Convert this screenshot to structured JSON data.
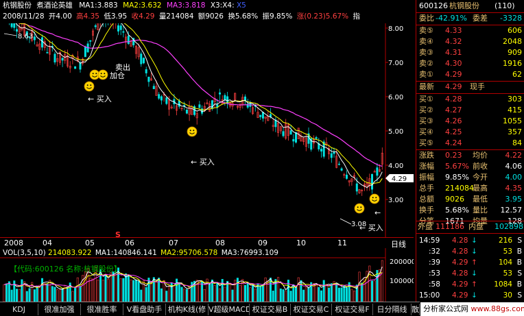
{
  "info": {
    "stock_name": "杭钢股份",
    "strategy_name": "煮酒论英雄",
    "ma1": "MA1:3.883",
    "ma2": "MA2:3.632",
    "ma3": "MA3:3.818",
    "x3x4": "X3:X4:",
    "x5": "X5",
    "date": "2008/11/28",
    "open": "开4.00",
    "high": "高4.35",
    "low": "低3.95",
    "close": "收4.29",
    "volume": "量214084",
    "amount": "额9026",
    "turnover": "换5.68%",
    "amplitude": "振9.85%",
    "change": "涨(0.23)5.67%",
    "index_label": "指"
  },
  "main_chart": {
    "price_labels": [
      "8.00",
      "7.00",
      "6.00",
      "5.00",
      "4.00",
      "3.00"
    ],
    "price_values": [
      8,
      7,
      6,
      5,
      4,
      3
    ],
    "current_price_tag": "4.29",
    "high_marker": "8.63",
    "low_marker": "3.08",
    "buy_labels": [
      "买入",
      "买入",
      "买入"
    ],
    "sell_labels": [
      "卖出",
      "加仓"
    ],
    "sell_label_main": "卖出",
    "add_label": "加仓",
    "s_marker": "S"
  },
  "date_axis": {
    "labels": [
      "2008",
      "04",
      "05",
      "06",
      "07",
      "08",
      "09",
      "10",
      "11"
    ],
    "period": "日线"
  },
  "vol_chart": {
    "header_label": "VOL(3,5,10)",
    "vol_value": "214083.922",
    "ma1": "MA1:140846.141",
    "ma2": "MA2:95706.578",
    "ma3": "MA3:76993.109",
    "watermark": "【代码:600126 名称:杭钢股份】",
    "scale_labels": [
      "200000",
      "100000"
    ]
  },
  "tabs": [
    "KDJ",
    "很准加强",
    "很准胜率",
    "V看盘助手",
    "机构K线(修",
    "V超级MACD",
    "权证交易B",
    "权证交易C",
    "权证交易F",
    "日分隔线",
    "散"
  ],
  "footer": {
    "brand": "分析家公式网",
    "site": "www.88gs.com"
  },
  "quote": {
    "code": "600126",
    "name": "杭钢股份",
    "id_suffix": "(110)",
    "weibi_label": "委比",
    "weibi_value": "-42.91%",
    "weicha_label": "委差",
    "weicha_value": "-3328",
    "sells": [
      {
        "label": "卖⑤",
        "price": "4.33",
        "vol": "606"
      },
      {
        "label": "卖④",
        "price": "4.32",
        "vol": "2048"
      },
      {
        "label": "卖③",
        "price": "4.31",
        "vol": "909"
      },
      {
        "label": "卖②",
        "price": "4.30",
        "vol": "1916"
      },
      {
        "label": "卖①",
        "price": "4.29",
        "vol": "62"
      }
    ],
    "last_label": "最新",
    "last_value": "4.29",
    "now_hand_label": "现手",
    "buys": [
      {
        "label": "买①",
        "price": "4.28",
        "vol": "303"
      },
      {
        "label": "买②",
        "price": "4.27",
        "vol": "415"
      },
      {
        "label": "买③",
        "price": "4.26",
        "vol": "1055"
      },
      {
        "label": "买④",
        "price": "4.25",
        "vol": "357"
      },
      {
        "label": "买⑤",
        "price": "4.24",
        "vol": "84"
      }
    ],
    "stats": [
      {
        "l1": "涨跌",
        "v1": "0.23",
        "l2": "均价",
        "v2": "4.22"
      },
      {
        "l1": "涨幅",
        "v1": "5.67%",
        "l2": "前收",
        "v2": "4.06"
      },
      {
        "l1": "振幅",
        "v1": "9.85%",
        "l2": "今开",
        "v2": "4.00"
      },
      {
        "l1": "总手",
        "v1": "214084",
        "l2": "最高",
        "v2": "4.35"
      },
      {
        "l1": "总额",
        "v1": "9026",
        "l2": "最低",
        "v2": "3.95"
      },
      {
        "l1": "换手",
        "v1": "5.68%",
        "l2": "量比",
        "v2": "12.57"
      },
      {
        "l1": "分笔",
        "v1": "1671",
        "l2": "均量",
        "v2": "128"
      }
    ],
    "outer_label": "外盘",
    "outer_value": "111186",
    "inner_label": "内盘",
    "inner_value": "102898",
    "ticks": [
      {
        "time": "14:59",
        "price": "4.28",
        "arrow": "↓",
        "vol": "216",
        "side": "S"
      },
      {
        "time": ":32",
        "price": "4.28",
        "arrow": "↓",
        "vol": "53",
        "side": "B"
      },
      {
        "time": ":39",
        "price": "4.29",
        "arrow": "↑",
        "vol": "104",
        "side": "B"
      },
      {
        "time": ":53",
        "price": "4.28",
        "arrow": "↓",
        "vol": "53",
        "side": "S"
      },
      {
        "time": ":58",
        "price": "4.29",
        "arrow": "↑",
        "vol": "1084",
        "side": "B"
      },
      {
        "time": "15:00",
        "price": "4.29",
        "arrow": "↓",
        "vol": "30",
        "side": "S"
      }
    ]
  },
  "colors": {
    "ma1": "#ffffff",
    "ma2": "#ffff00",
    "ma3": "#ff40ff",
    "up": "#ff4040",
    "down": "#00e0e0",
    "frame": "#b00000"
  }
}
